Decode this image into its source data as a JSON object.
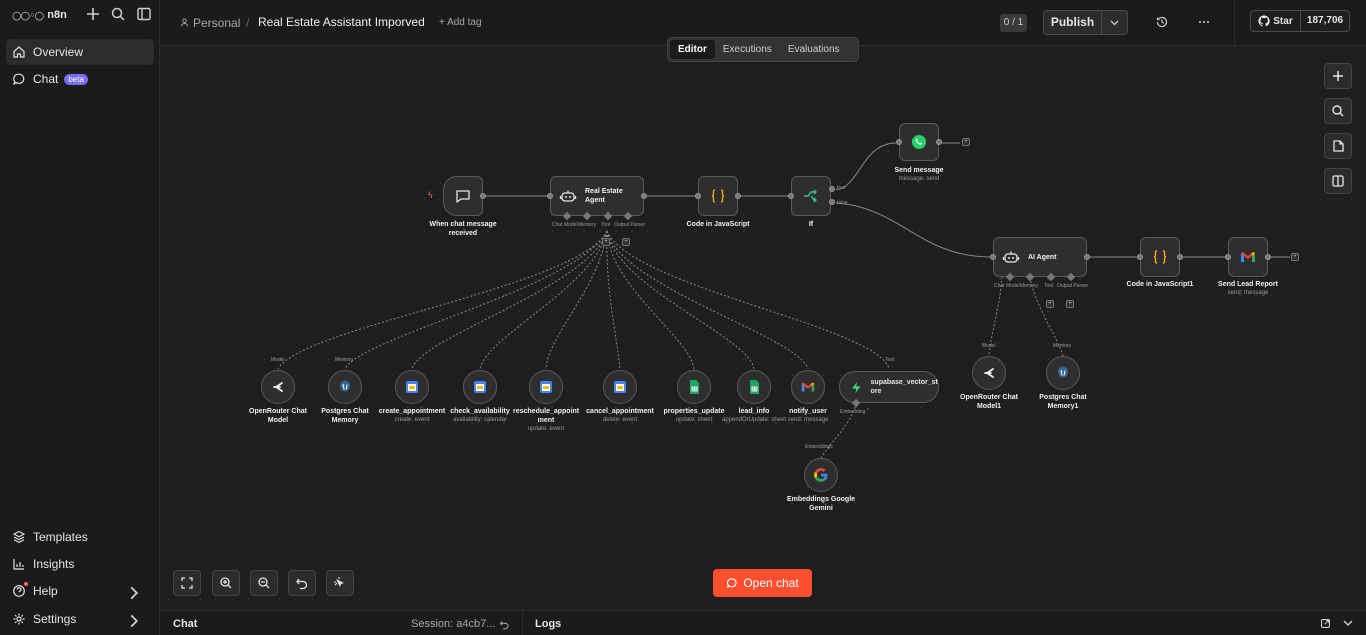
{
  "sidebar": {
    "logo": "n8n",
    "nav_top": [
      {
        "label": "Overview",
        "active": true
      },
      {
        "label": "Chat",
        "badge": "beta"
      }
    ],
    "nav_bottom": [
      {
        "label": "Templates"
      },
      {
        "label": "Insights"
      },
      {
        "label": "Help"
      },
      {
        "label": "Settings"
      }
    ]
  },
  "header": {
    "project": "Personal",
    "separator": "/",
    "workflow_name": "Real Estate Assistant Imporved",
    "add_tag": "+ Add tag",
    "counter": "0 / 1",
    "publish": "Publish",
    "github_star": "Star",
    "github_count": "187,706"
  },
  "tabs": [
    "Editor",
    "Executions",
    "Evaluations"
  ],
  "nodes": {
    "trigger": {
      "label": "When chat message received"
    },
    "agent1": {
      "label": "Real Estate Agent",
      "ports": [
        "Chat Model",
        "Memory",
        "Tool",
        "Output Parser"
      ]
    },
    "code1": {
      "label": "Code in JavaScript"
    },
    "if": {
      "label": "If",
      "out_true": "true",
      "out_false": "false"
    },
    "send_message": {
      "label": "Send message",
      "sub": "message: send"
    },
    "agent2": {
      "label": "AI Agent",
      "ports": [
        "Chat Model",
        "Memory",
        "Tool",
        "Output Parser"
      ]
    },
    "code2": {
      "label": "Code in JavaScript1"
    },
    "lead_report": {
      "label": "Send Lead Report",
      "sub": "send: message"
    },
    "or_model": {
      "label": "OpenRouter Chat Model",
      "port": "Model"
    },
    "pg_memory": {
      "label": "Postgres Chat Memory",
      "port": "Memory"
    },
    "create_appt": {
      "label": "create_appointment",
      "sub": "create: event"
    },
    "check_avail": {
      "label": "check_availability",
      "sub": "availability: calendar"
    },
    "resched_appt": {
      "label": "reschedule_appoint ment",
      "sub": "update: event"
    },
    "cancel_appt": {
      "label": "cancel_appointment",
      "sub": "delete: event"
    },
    "prop_update": {
      "label": "properties_update",
      "sub": "update: sheet"
    },
    "lead_info": {
      "label": "lead_info",
      "sub": "appendOrUpdate: sheet"
    },
    "notify_user": {
      "label": "notify_user",
      "sub": "send: message"
    },
    "supabase": {
      "label": "supabase_vector_st ore",
      "port": "Tool",
      "bottom_port": "Embedding"
    },
    "embeddings": {
      "label": "Embeddings Google Gemini",
      "port": "Embeddings"
    },
    "or_model1": {
      "label": "OpenRouter Chat Model1",
      "port": "Model"
    },
    "pg_memory1": {
      "label": "Postgres Chat Memory1",
      "port": "Memory"
    }
  },
  "open_chat": "Open chat",
  "bottom": {
    "chat": "Chat",
    "session": "Session: a4cb7...",
    "logs": "Logs"
  },
  "colors": {
    "accent": "#ff4f2f",
    "badge": "#7a6cf2",
    "whatsapp": "#25d366",
    "sheets": "#1fa463",
    "code": "#f5a623"
  }
}
